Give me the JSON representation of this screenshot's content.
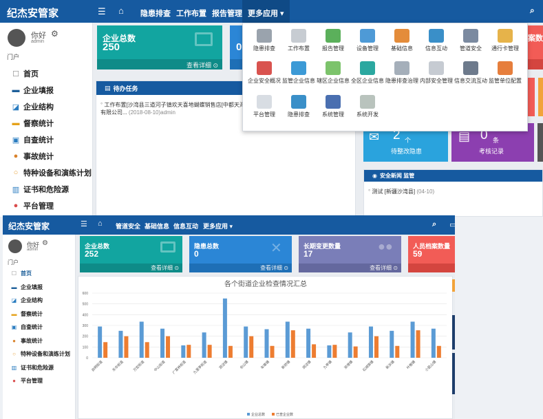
{
  "top": {
    "brand": "纪杰安管家",
    "nav": [
      "隐患排查",
      "工作布置",
      "报告管理",
      "更多应用 ▾"
    ],
    "user_greeting": "你好",
    "user_role": "admin",
    "portal_label": "门户",
    "sidebar": [
      "首页",
      "企业填报",
      "企业结构",
      "督察统计",
      "自查统计",
      "事故统计",
      "特种设备和演练计划",
      "证书和危险源",
      "平台管理"
    ],
    "card_total": {
      "label": "企业总数",
      "value": "250",
      "footer": "查看详细"
    },
    "partial_value": "0",
    "partial_right_label": "案数量",
    "task_panel": {
      "title": "待办任务",
      "line1": "工作布置[沙湾县三道河子镇欢天喜地蝴蝶销售店[中都天海眼镜",
      "line2a": "有限公司...",
      "line2b": "(2018-08-10)admin"
    },
    "dropdown_apps": [
      "隐患排查",
      "工作布置",
      "报告管理",
      "设备管理",
      "基础信息",
      "信息互动",
      "管道安全",
      "通行卡管理",
      "企业安全概况",
      "监管企业信息",
      "辖区企业信息",
      "全区企业信息",
      "隐患排查治理",
      "内部安全管理",
      "信息交流互动",
      "监管单位配置",
      "平台管理",
      "隐患排查",
      "系统管理",
      "系统开发"
    ],
    "card_rectify": {
      "value": "2",
      "unit": "个",
      "label": "待整改隐患"
    },
    "card_exam": {
      "value": "0",
      "unit": "条",
      "label": "考核记录"
    },
    "news_panel": {
      "title": "安全新闻 监管",
      "item_title": "测试 [新疆沙湾县]",
      "item_date": "(04-10)"
    }
  },
  "bottom": {
    "brand": "纪杰安管家",
    "nav": [
      "管道安全",
      "基础信息",
      "信息互动",
      "更多应用 ▾"
    ],
    "user_greeting": "你好",
    "user_role": "admin",
    "portal_label": "门户",
    "sidebar": [
      "首页",
      "企业填报",
      "企业结构",
      "督察统计",
      "自查统计",
      "事故统计",
      "特种设备和演练计划",
      "证书和危险源",
      "平台管理"
    ],
    "cards": [
      {
        "label": "企业总数",
        "value": "252",
        "footer": "查看详细",
        "color": "#12a5a0"
      },
      {
        "label": "隐患总数",
        "value": "0",
        "footer": "查看详细",
        "color": "#2b86d6"
      },
      {
        "label": "长期变更数量",
        "value": "17",
        "footer": "查看详细",
        "color": "#7a7eb8"
      },
      {
        "label": "人员档案数量",
        "value": "59",
        "footer": "",
        "color": "#f25c56"
      }
    ]
  },
  "colors": {
    "navbar": "#165aa0",
    "series_total": "#5b9bd5",
    "series_safe": "#ed7d31"
  },
  "chart_data": {
    "type": "bar",
    "title": "各个街道企业检查情况汇总",
    "categories": [
      "启明街道",
      "东华街道",
      "万宏街道",
      "中山街道",
      "广富林街道",
      "九里亭街道",
      "泗泾镇",
      "佘山镇",
      "车墩镇",
      "新桥镇",
      "洞泾镇",
      "九亭镇",
      "泖港镇",
      "石湖荡镇",
      "新浜镇",
      "叶榭镇",
      "小昆山镇"
    ],
    "series": [
      {
        "name": "企业总数",
        "values": [
          290,
          250,
          335,
          270,
          115,
          235,
          550,
          290,
          265,
          335,
          270,
          115,
          235,
          290,
          250,
          335,
          270
        ]
      },
      {
        "name": "已查企业数",
        "values": [
          145,
          200,
          145,
          200,
          120,
          120,
          110,
          200,
          110,
          255,
          125,
          120,
          105,
          200,
          110,
          255,
          110
        ]
      }
    ],
    "ylim": [
      0,
      600
    ],
    "yticks": [
      0,
      100,
      200,
      300,
      400,
      500,
      600
    ],
    "grid": true,
    "legend": "bottom"
  }
}
